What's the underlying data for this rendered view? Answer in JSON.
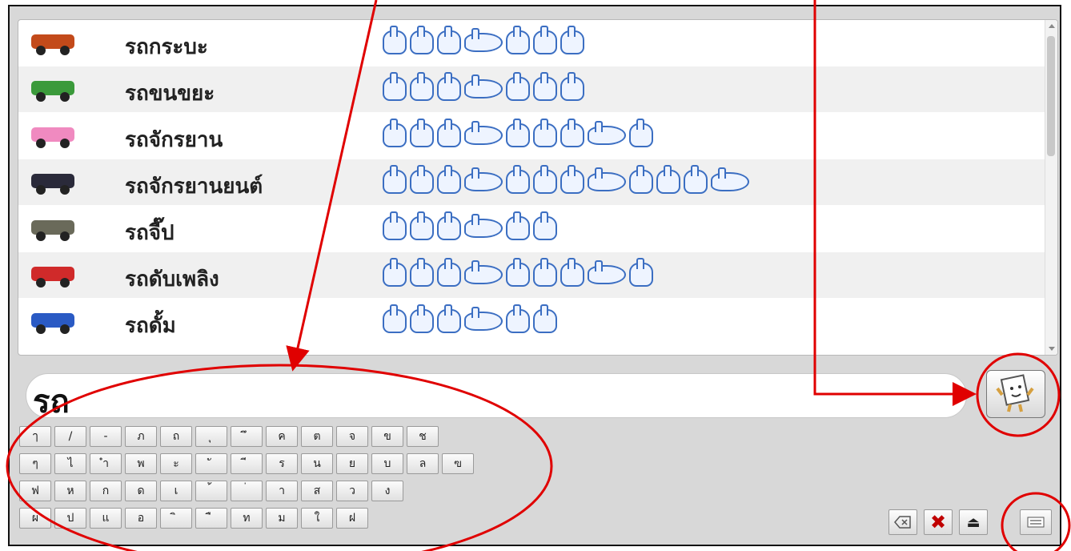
{
  "rows": [
    {
      "word": "รถกระบะ",
      "pic": "pickup-truck-photo",
      "signs": 7
    },
    {
      "word": "รถขนขยะ",
      "pic": "garbage-truck-photo",
      "signs": 7
    },
    {
      "word": "รถจักรยาน",
      "pic": "bicycle-photo",
      "signs": 9
    },
    {
      "word": "รถจักรยานยนต์",
      "pic": "motorcycle-photo",
      "signs": 12
    },
    {
      "word": "รถจี๊ป",
      "pic": "jeep-photo",
      "signs": 6
    },
    {
      "word": "รถดับเพลิง",
      "pic": "fire-truck-photo",
      "signs": 9
    },
    {
      "word": "รถดั้ม",
      "pic": "dump-truck-photo",
      "signs": 6
    }
  ],
  "input": {
    "value": "รถ"
  },
  "keyboard": {
    "row1": [
      "ๅ",
      "/",
      "-",
      "ภ",
      "ถ",
      "ุ",
      "ึ",
      "ค",
      "ต",
      "จ",
      "ข",
      "ช"
    ],
    "row2": [
      "ๆ",
      "ไ",
      "ำ",
      "พ",
      "ะ",
      "ั",
      "ี",
      "ร",
      "น",
      "ย",
      "บ",
      "ล",
      "ฃ"
    ],
    "row3": [
      "ฟ",
      "ห",
      "ก",
      "ด",
      "เ",
      "้",
      "่",
      "า",
      "ส",
      "ว",
      "ง"
    ],
    "row4": [
      "ผ",
      "ป",
      "แ",
      "อ",
      "ิ",
      "ื",
      "ท",
      "ม",
      "ใ",
      "ฝ"
    ]
  },
  "icons": {
    "translate": "sign-translate-icon",
    "backspace": "backspace-icon",
    "clear": "clear-x-icon",
    "eject": "eject-icon",
    "keyboard": "keyboard-toggle-icon"
  },
  "colors": {
    "annotation": "#e00000",
    "hand": "#3b6ec2"
  }
}
